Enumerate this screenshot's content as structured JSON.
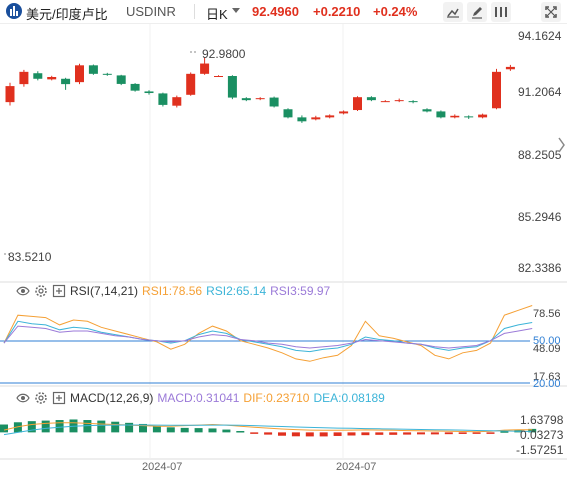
{
  "header": {
    "pair_name": "美元/印度卢比",
    "symbol": "USDINR",
    "timeframe": "日K",
    "price": "92.4960",
    "change": "+0.2210",
    "change_pct": "+0.24%",
    "up_color": "#e0301e",
    "tools": [
      "draw-line-icon",
      "pencil-icon",
      "visibility-icon",
      "fullscreen-icon"
    ]
  },
  "main": {
    "y_ticks": [
      "94.1624",
      "91.2064",
      "88.2505",
      "85.2946",
      "82.3386"
    ],
    "high_label": "92.9800",
    "low_label": "83.5210"
  },
  "rsi": {
    "label": "RSI(7,14,21)",
    "rsi1": "RSI1:78.56",
    "rsi2": "RSI2:65.14",
    "rsi3": "RSI3:59.97",
    "y_ticks": [
      "78.56",
      "50.00",
      "48.09",
      "17.63",
      "20.00"
    ]
  },
  "macd": {
    "label": "MACD(12,26,9)",
    "macd": "MACD:0.31041",
    "dif": "DIF:0.23710",
    "dea": "DEA:0.08189",
    "y_ticks": [
      "1.63798",
      "0.03273",
      "-1.57251"
    ]
  },
  "x_axis": [
    "2024-07",
    "2024-07"
  ],
  "chart_data": [
    {
      "type": "candlestick",
      "title": "",
      "xlabel": "",
      "ylabel": "",
      "ylim": [
        82.3386,
        94.1624
      ],
      "up_color": "#e0301e",
      "down_color": "#1a8f62",
      "candles": [
        {
          "o": 90.72,
          "c": 91.53,
          "h": 91.7,
          "l": 90.55
        },
        {
          "o": 91.63,
          "c": 92.25,
          "h": 92.35,
          "l": 91.5
        },
        {
          "o": 92.18,
          "c": 91.9,
          "h": 92.28,
          "l": 91.82
        },
        {
          "o": 91.87,
          "c": 91.99,
          "h": 92.05,
          "l": 91.82
        },
        {
          "o": 91.9,
          "c": 91.63,
          "h": 91.95,
          "l": 91.34
        },
        {
          "o": 91.73,
          "c": 92.58,
          "h": 92.66,
          "l": 91.63
        },
        {
          "o": 92.58,
          "c": 92.15,
          "h": 92.62,
          "l": 92.1
        },
        {
          "o": 92.15,
          "c": 92.12,
          "h": 92.2,
          "l": 92.05
        },
        {
          "o": 92.07,
          "c": 91.64,
          "h": 92.1,
          "l": 91.58
        },
        {
          "o": 91.64,
          "c": 91.3,
          "h": 91.68,
          "l": 91.25
        },
        {
          "o": 91.26,
          "c": 91.18,
          "h": 91.32,
          "l": 91.1
        },
        {
          "o": 91.16,
          "c": 90.58,
          "h": 91.2,
          "l": 90.5
        },
        {
          "o": 90.54,
          "c": 90.97,
          "h": 91.05,
          "l": 90.45
        },
        {
          "o": 91.09,
          "c": 92.15,
          "h": 92.22,
          "l": 91.04
        },
        {
          "o": 92.15,
          "c": 92.67,
          "h": 92.98,
          "l": 92.1
        },
        {
          "o": 92.04,
          "c": 92.04,
          "h": 92.08,
          "l": 92.0
        },
        {
          "o": 92.04,
          "c": 90.95,
          "h": 92.08,
          "l": 90.87
        },
        {
          "o": 90.92,
          "c": 90.82,
          "h": 90.97,
          "l": 90.77
        },
        {
          "o": 90.87,
          "c": 90.92,
          "h": 90.97,
          "l": 90.82
        },
        {
          "o": 90.95,
          "c": 90.5,
          "h": 91.0,
          "l": 90.45
        },
        {
          "o": 90.36,
          "c": 89.95,
          "h": 90.41,
          "l": 89.9
        },
        {
          "o": 89.95,
          "c": 89.75,
          "h": 90.05,
          "l": 89.67
        },
        {
          "o": 89.85,
          "c": 89.95,
          "h": 90.03,
          "l": 89.8
        },
        {
          "o": 89.95,
          "c": 90.05,
          "h": 90.1,
          "l": 89.9
        },
        {
          "o": 90.15,
          "c": 90.25,
          "h": 90.3,
          "l": 90.1
        },
        {
          "o": 90.32,
          "c": 90.97,
          "h": 91.02,
          "l": 90.27
        },
        {
          "o": 90.97,
          "c": 90.82,
          "h": 91.02,
          "l": 90.77
        },
        {
          "o": 90.77,
          "c": 90.77,
          "h": 90.82,
          "l": 90.73
        },
        {
          "o": 90.77,
          "c": 90.82,
          "h": 90.9,
          "l": 90.72
        },
        {
          "o": 90.77,
          "c": 90.72,
          "h": 90.82,
          "l": 90.66
        },
        {
          "o": 90.36,
          "c": 90.25,
          "h": 90.41,
          "l": 90.2
        },
        {
          "o": 90.25,
          "c": 89.95,
          "h": 90.3,
          "l": 89.9
        },
        {
          "o": 89.95,
          "c": 90.03,
          "h": 90.1,
          "l": 89.9
        },
        {
          "o": 90.0,
          "c": 89.95,
          "h": 90.05,
          "l": 89.87
        },
        {
          "o": 89.95,
          "c": 90.09,
          "h": 90.14,
          "l": 89.9
        },
        {
          "o": 90.41,
          "c": 92.25,
          "h": 92.4,
          "l": 90.36
        },
        {
          "o": 92.38,
          "c": 92.5,
          "h": 92.6,
          "l": 92.3
        }
      ]
    },
    {
      "type": "line",
      "title": "",
      "ylim": [
        17.63,
        78.56
      ],
      "series": [
        {
          "name": "RSI1",
          "color": "#f5a035",
          "values": [
            48,
            71,
            70,
            69,
            63,
            67,
            66,
            61,
            58,
            55,
            52,
            49,
            43,
            47,
            56,
            62,
            58,
            50,
            47,
            44,
            40,
            35,
            33,
            36,
            38,
            46,
            66,
            54,
            52,
            49,
            46,
            38,
            35,
            40,
            42,
            48,
            71,
            75,
            79
          ]
        },
        {
          "name": "RSI2",
          "color": "#3cb4d8",
          "values": [
            48,
            66,
            64,
            63,
            59,
            61,
            60,
            57,
            55,
            53,
            51,
            50,
            48,
            50,
            55,
            58,
            56,
            51,
            49,
            47,
            45,
            42,
            41,
            43,
            44,
            47,
            53,
            51,
            50,
            48,
            47,
            44,
            42,
            44,
            45,
            50,
            60,
            63,
            65
          ]
        },
        {
          "name": "RSI3",
          "color": "#9b7ad8",
          "values": [
            48,
            62,
            61,
            60,
            57,
            58,
            58,
            56,
            54,
            53,
            51,
            50,
            49,
            50,
            53,
            55,
            54,
            51,
            50,
            48,
            47,
            45,
            44,
            45,
            46,
            48,
            51,
            50,
            49,
            48,
            47,
            45,
            44,
            45,
            46,
            50,
            56,
            58,
            60
          ]
        }
      ]
    },
    {
      "type": "bar",
      "title": "",
      "ylim": [
        -1.57251,
        1.63798
      ],
      "values": [
        0.7,
        0.9,
        1.0,
        1.05,
        1.1,
        1.15,
        1.1,
        1.05,
        0.95,
        0.85,
        0.75,
        0.55,
        0.45,
        0.4,
        0.38,
        0.35,
        0.25,
        0.12,
        -0.08,
        -0.2,
        -0.3,
        -0.35,
        -0.36,
        -0.36,
        -0.32,
        -0.28,
        -0.25,
        -0.22,
        -0.22,
        -0.2,
        -0.18,
        -0.18,
        -0.16,
        -0.14,
        -0.12,
        -0.05,
        0.1,
        0.2,
        0.31
      ],
      "series": [
        {
          "name": "DIF",
          "color": "#f5a035",
          "values": [
            0.2,
            0.5,
            0.7,
            0.8,
            0.85,
            0.85,
            0.8,
            0.75,
            0.7,
            0.65,
            0.6,
            0.55,
            0.55,
            0.6,
            0.65,
            0.7,
            0.65,
            0.55,
            0.45,
            0.38,
            0.3,
            0.25,
            0.2,
            0.18,
            0.18,
            0.2,
            0.22,
            0.2,
            0.18,
            0.16,
            0.14,
            0.12,
            0.1,
            0.08,
            0.06,
            0.1,
            0.2,
            0.23,
            0.24
          ]
        },
        {
          "name": "DEA",
          "color": "#3cb4d8",
          "values": [
            -0.2,
            0.0,
            0.2,
            0.35,
            0.45,
            0.55,
            0.6,
            0.63,
            0.65,
            0.66,
            0.66,
            0.65,
            0.64,
            0.64,
            0.64,
            0.65,
            0.65,
            0.63,
            0.6,
            0.56,
            0.52,
            0.48,
            0.44,
            0.41,
            0.38,
            0.36,
            0.34,
            0.32,
            0.3,
            0.28,
            0.26,
            0.24,
            0.22,
            0.2,
            0.17,
            0.15,
            0.12,
            0.1,
            0.08
          ]
        }
      ]
    }
  ]
}
